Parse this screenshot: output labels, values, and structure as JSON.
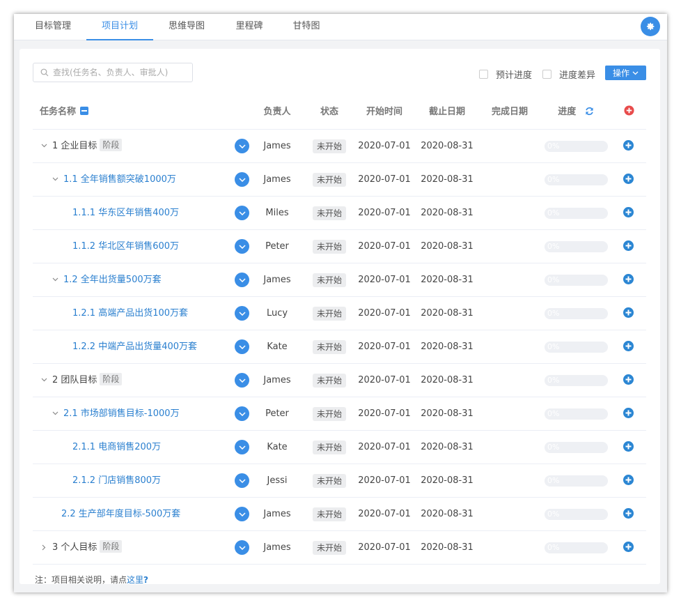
{
  "tabs": [
    {
      "label": "目标管理",
      "active": false
    },
    {
      "label": "项目计划",
      "active": true
    },
    {
      "label": "思维导图",
      "active": false
    },
    {
      "label": "里程碑",
      "active": false
    },
    {
      "label": "甘特图",
      "active": false
    }
  ],
  "toolbar": {
    "search_placeholder": "查找(任务名、负责人、审批人)",
    "checkbox_planned": "预计进度",
    "checkbox_diff": "进度差异",
    "operate_label": "操作"
  },
  "columns": {
    "task": "任务名称",
    "owner": "负责人",
    "status": "状态",
    "start": "开始时间",
    "due": "截止日期",
    "done": "完成日期",
    "progress": "进度"
  },
  "rows": [
    {
      "level": 0,
      "toggle": "expanded",
      "label": "1 企业目标",
      "stage": "阶段",
      "owner": "James",
      "status": "未开始",
      "start": "2020-07-01",
      "due": "2020-08-31",
      "done": "",
      "progress": "0%",
      "progress_value": 0
    },
    {
      "level": 1,
      "toggle": "expanded",
      "label": "1.1 全年销售额突破1000万",
      "stage": "",
      "owner": "James",
      "status": "未开始",
      "start": "2020-07-01",
      "due": "2020-08-31",
      "done": "",
      "progress": "0%",
      "progress_value": 0
    },
    {
      "level": 2,
      "toggle": "none",
      "label": "1.1.1 华东区年销售400万",
      "stage": "",
      "owner": "Miles",
      "status": "未开始",
      "start": "2020-07-01",
      "due": "2020-08-31",
      "done": "",
      "progress": "0%",
      "progress_value": 0
    },
    {
      "level": 2,
      "toggle": "none",
      "label": "1.1.2 华北区年销售600万",
      "stage": "",
      "owner": "Peter",
      "status": "未开始",
      "start": "2020-07-01",
      "due": "2020-08-31",
      "done": "",
      "progress": "0%",
      "progress_value": 0
    },
    {
      "level": 1,
      "toggle": "expanded",
      "label": "1.2 全年出货量500万套",
      "stage": "",
      "owner": "James",
      "status": "未开始",
      "start": "2020-07-01",
      "due": "2020-08-31",
      "done": "",
      "progress": "0%",
      "progress_value": 0
    },
    {
      "level": 2,
      "toggle": "none",
      "label": "1.2.1 高端产品出货100万套",
      "stage": "",
      "owner": "Lucy",
      "status": "未开始",
      "start": "2020-07-01",
      "due": "2020-08-31",
      "done": "",
      "progress": "0%",
      "progress_value": 0
    },
    {
      "level": 2,
      "toggle": "none",
      "label": "1.2.2 中端产品出货量400万套",
      "stage": "",
      "owner": "Kate",
      "status": "未开始",
      "start": "2020-07-01",
      "due": "2020-08-31",
      "done": "",
      "progress": "0%",
      "progress_value": 0
    },
    {
      "level": 0,
      "toggle": "expanded",
      "label": "2 团队目标",
      "stage": "阶段",
      "owner": "James",
      "status": "未开始",
      "start": "2020-07-01",
      "due": "2020-08-31",
      "done": "",
      "progress": "0%",
      "progress_value": 0
    },
    {
      "level": 1,
      "toggle": "expanded",
      "label": "2.1 市场部销售目标-1000万",
      "stage": "",
      "owner": "Peter",
      "status": "未开始",
      "start": "2020-07-01",
      "due": "2020-08-31",
      "done": "",
      "progress": "0%",
      "progress_value": 0
    },
    {
      "level": 2,
      "toggle": "none",
      "label": "2.1.1 电商销售200万",
      "stage": "",
      "owner": "Kate",
      "status": "未开始",
      "start": "2020-07-01",
      "due": "2020-08-31",
      "done": "",
      "progress": "0%",
      "progress_value": 0
    },
    {
      "level": 2,
      "toggle": "none",
      "label": "2.1.2 门店销售800万",
      "stage": "",
      "owner": "Jessi",
      "status": "未开始",
      "start": "2020-07-01",
      "due": "2020-08-31",
      "done": "",
      "progress": "0%",
      "progress_value": 0
    },
    {
      "level": 1,
      "toggle": "none",
      "label": "2.2 生产部年度目标-500万套",
      "stage": "",
      "owner": "James",
      "status": "未开始",
      "start": "2020-07-01",
      "due": "2020-08-31",
      "done": "",
      "progress": "0%",
      "progress_value": 0
    },
    {
      "level": 0,
      "toggle": "collapsed",
      "label": "3 个人目标",
      "stage": "阶段",
      "owner": "James",
      "status": "未开始",
      "start": "2020-07-01",
      "due": "2020-08-31",
      "done": "",
      "progress": "0%",
      "progress_value": 0
    }
  ],
  "footer": {
    "note_prefix": "注：项目相关说明，请点",
    "note_link": "这里",
    "note_icon": "?"
  },
  "colors": {
    "accent": "#3a8ee6",
    "link": "#2a7fcf",
    "danger": "#e84b4b"
  }
}
